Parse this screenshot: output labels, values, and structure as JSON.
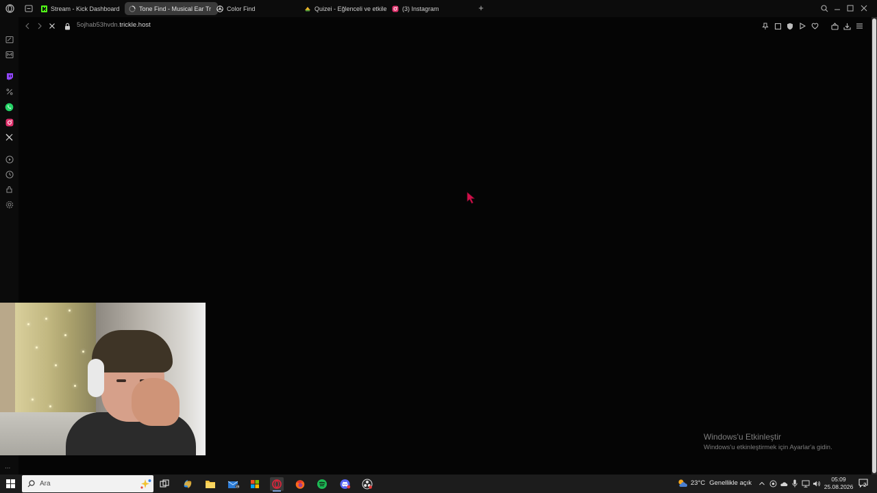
{
  "browser": {
    "tabs": [
      {
        "label": "Stream - Kick Dashboard",
        "favicon": "kick-icon",
        "active": false
      },
      {
        "label": "Tone Find - Musical Ear Tr",
        "favicon": "loading-spinner-icon",
        "active": true
      },
      {
        "label": "Color Find",
        "favicon": "color-find-icon",
        "active": false
      },
      {
        "label": "Quizei - Eğlenceli ve etkile",
        "favicon": "quizei-icon",
        "active": false
      },
      {
        "label": "(3) Instagram",
        "favicon": "instagram-icon",
        "active": false
      }
    ],
    "address": {
      "subdomain": "5ojhab53hvdn.",
      "host": "trickle.host"
    }
  },
  "sidebar": {
    "icons": [
      "notes-icon",
      "mail-icon",
      "twitch-icon",
      "percent-icon",
      "whatsapp-icon",
      "instagram-icon",
      "x-icon",
      "play-circle-icon",
      "history-icon",
      "extensions-icon",
      "settings-icon"
    ],
    "more": "..."
  },
  "watermark": {
    "title": "Windows'u Etkinleştir",
    "subtitle": "Windows'u etkinleştirmek için Ayarlar'a gidin."
  },
  "taskbar": {
    "search_placeholder": "Ara",
    "apps": [
      "task-view-icon",
      "copilot-icon",
      "file-explorer-icon",
      "mail-app-icon",
      "ms-store-icon",
      "opera-browser-icon",
      "firefox-icon",
      "spotify-icon",
      "discord-icon",
      "obs-icon"
    ],
    "weather": {
      "temp": "23°C",
      "condition": "Genellikle açık"
    },
    "clock": {
      "time": "05:09",
      "date": "25.08.2026"
    },
    "notifications": "2"
  },
  "colors": {
    "accent_kick": "#53fc18",
    "cursor": "#d0104a",
    "whatsapp": "#25d366",
    "instagram": "#e1306c",
    "twitch": "#9146ff",
    "spotify": "#1db954"
  }
}
